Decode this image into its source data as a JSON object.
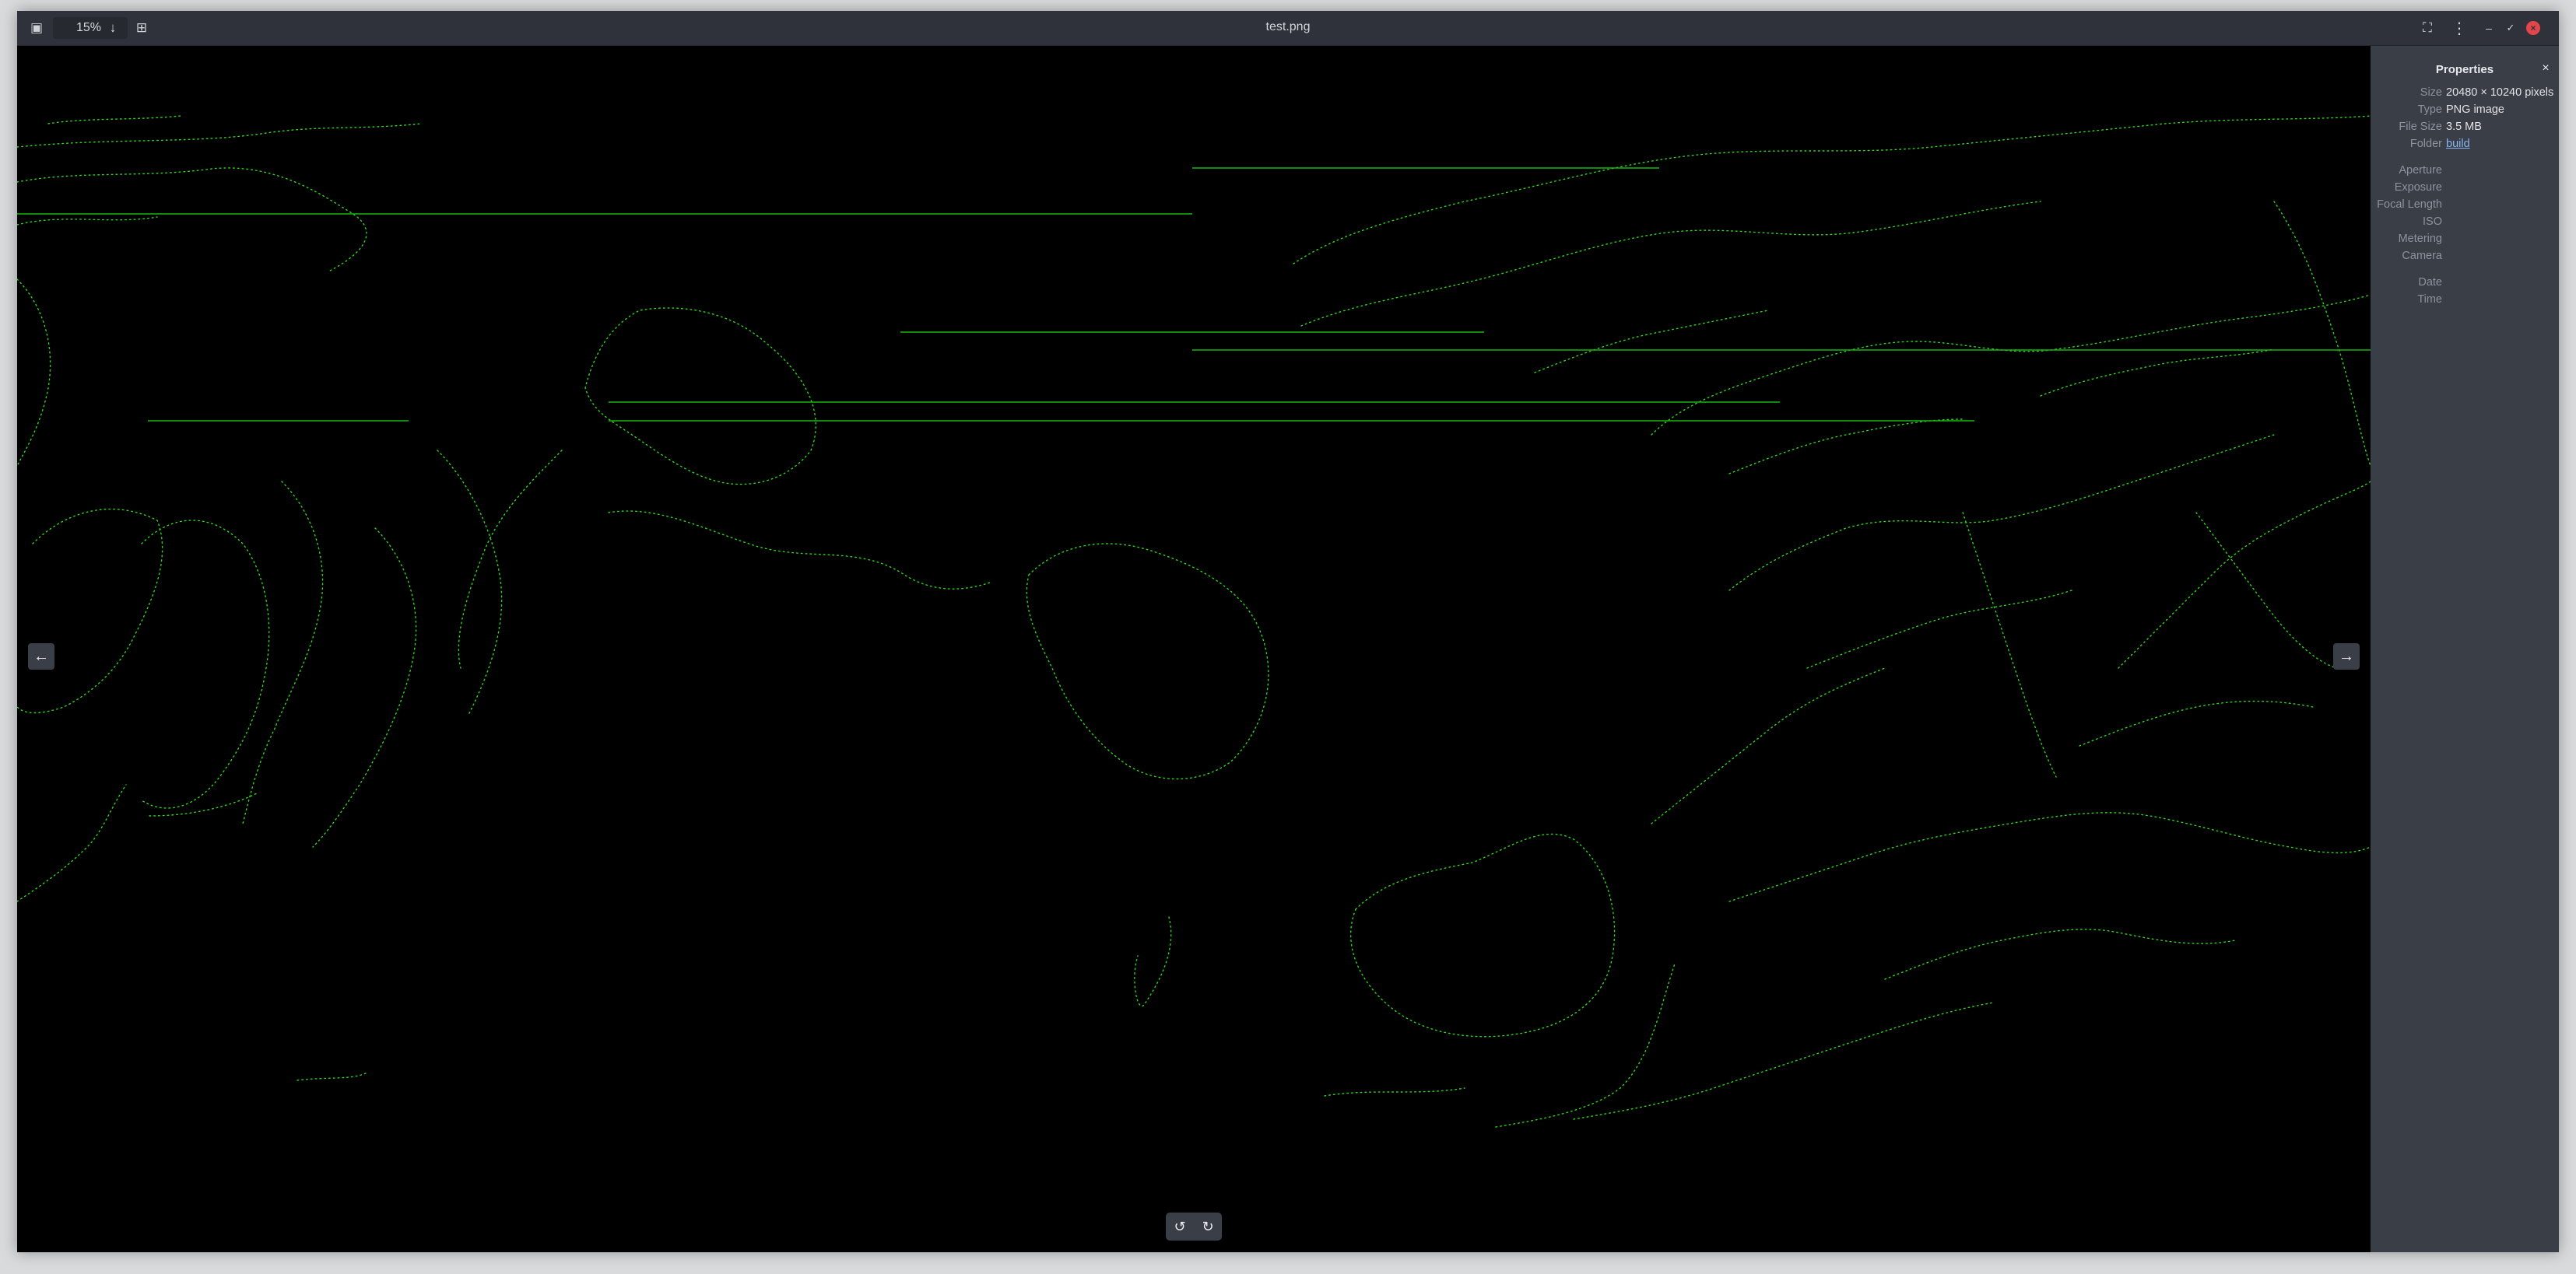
{
  "header": {
    "zoom_value": "15%",
    "title": "test.png"
  },
  "icons": {
    "zoom_out": "minus-square-icon",
    "zoom_in": "plus-square-icon",
    "zoom_menu": "arrow-down-icon",
    "fullscreen": "fullscreen-icon",
    "menu": "kebab-menu-icon",
    "minimize": "minimize-icon",
    "maximize": "maximize-icon",
    "close": "close-icon",
    "previous": "arrow-left-icon",
    "next": "arrow-right-icon",
    "rotate_left": "rotate-left-icon",
    "rotate_right": "rotate-right-icon"
  },
  "colors": {
    "headerbar": "#2f323a",
    "panel": "#3a3e47",
    "canvas": "#000000",
    "map_dots": "#2fd51e",
    "close_button": "#e2464b",
    "link": "#89b4f0"
  },
  "properties": {
    "title": "Properties",
    "rows": [
      {
        "label": "Size",
        "value": "20480 × 10240 pixels"
      },
      {
        "label": "Type",
        "value": "PNG image"
      },
      {
        "label": "File Size",
        "value": "3.5 MB"
      },
      {
        "label": "Folder",
        "value": "build",
        "link": true
      }
    ],
    "exif_rows": [
      {
        "label": "Aperture",
        "value": ""
      },
      {
        "label": "Exposure",
        "value": ""
      },
      {
        "label": "Focal Length",
        "value": ""
      },
      {
        "label": "ISO",
        "value": ""
      },
      {
        "label": "Metering",
        "value": ""
      },
      {
        "label": "Camera",
        "value": ""
      }
    ],
    "date_rows": [
      {
        "label": "Date",
        "value": ""
      },
      {
        "label": "Time",
        "value": ""
      }
    ]
  }
}
